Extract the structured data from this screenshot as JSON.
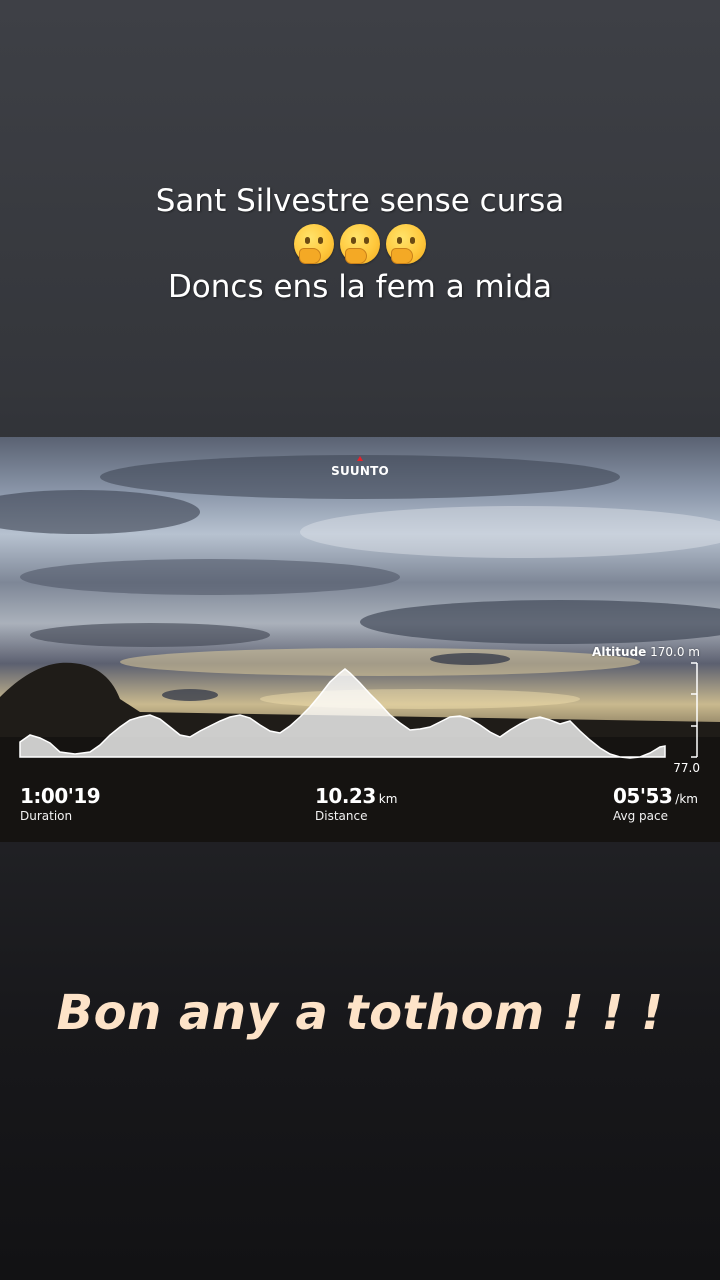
{
  "caption": {
    "line1": "Sant Silvestre sense cursa",
    "emojis": [
      "thinking-face",
      "thinking-face",
      "thinking-face"
    ],
    "line2": "Doncs ens la fem a mida"
  },
  "card": {
    "brand": "SUUNTO",
    "altitude_label": "Altitude",
    "altitude_max": "170.0 m",
    "altitude_min": "77.0",
    "stats": {
      "duration": {
        "value": "1:00'19",
        "unit": "",
        "label": "Duration"
      },
      "distance": {
        "value": "10.23",
        "unit": "km",
        "label": "Distance"
      },
      "pace": {
        "value": "05'53",
        "unit": "/km",
        "label": "Avg pace"
      }
    }
  },
  "greeting": "Bon any a tothom ! ! !",
  "colors": {
    "greeting": "#fde3c8",
    "brand_mark": "#e8212b"
  }
}
